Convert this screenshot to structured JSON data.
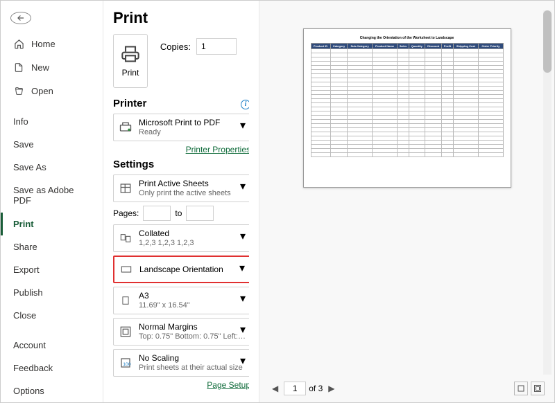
{
  "title": "Print",
  "sidebar": {
    "top": [
      {
        "label": "Home",
        "icon": "home"
      },
      {
        "label": "New",
        "icon": "new"
      },
      {
        "label": "Open",
        "icon": "open"
      }
    ],
    "mid": [
      {
        "label": "Info"
      },
      {
        "label": "Save"
      },
      {
        "label": "Save As"
      },
      {
        "label": "Save as Adobe PDF"
      },
      {
        "label": "Print",
        "active": true
      },
      {
        "label": "Share"
      },
      {
        "label": "Export"
      },
      {
        "label": "Publish"
      },
      {
        "label": "Close"
      }
    ],
    "bottom": [
      {
        "label": "Account"
      },
      {
        "label": "Feedback"
      },
      {
        "label": "Options"
      }
    ]
  },
  "print_button_label": "Print",
  "copies_label": "Copies:",
  "copies_value": "1",
  "printer_label": "Printer",
  "printer": {
    "name": "Microsoft Print to PDF",
    "status": "Ready"
  },
  "printer_properties_link": "Printer Properties",
  "settings_label": "Settings",
  "settings": {
    "print_what": {
      "main": "Print Active Sheets",
      "sub": "Only print the active sheets"
    },
    "pages_label": "Pages:",
    "pages_from": "",
    "pages_to_label": "to",
    "pages_to": "",
    "collate": {
      "main": "Collated",
      "sub": "1,2,3    1,2,3    1,2,3"
    },
    "orientation": {
      "main": "Landscape Orientation"
    },
    "paper": {
      "main": "A3",
      "sub": "11.69\" x 16.54\""
    },
    "margins": {
      "main": "Normal Margins",
      "sub": "Top: 0.75\" Bottom: 0.75\" Left:…"
    },
    "scaling": {
      "main": "No Scaling",
      "sub": "Print sheets at their actual size"
    }
  },
  "page_setup_link": "Page Setup",
  "preview": {
    "doc_title": "Changing the Orientation of the Worksheet to Landscape",
    "headers": [
      "Product ID",
      "Category",
      "Sub-Category",
      "Product Name",
      "Sales",
      "Quantity",
      "Discount",
      "Profit",
      "Shipping Cost",
      "Order Priority"
    ],
    "rows": 26
  },
  "pager": {
    "current": "1",
    "total_label": "of 3"
  }
}
